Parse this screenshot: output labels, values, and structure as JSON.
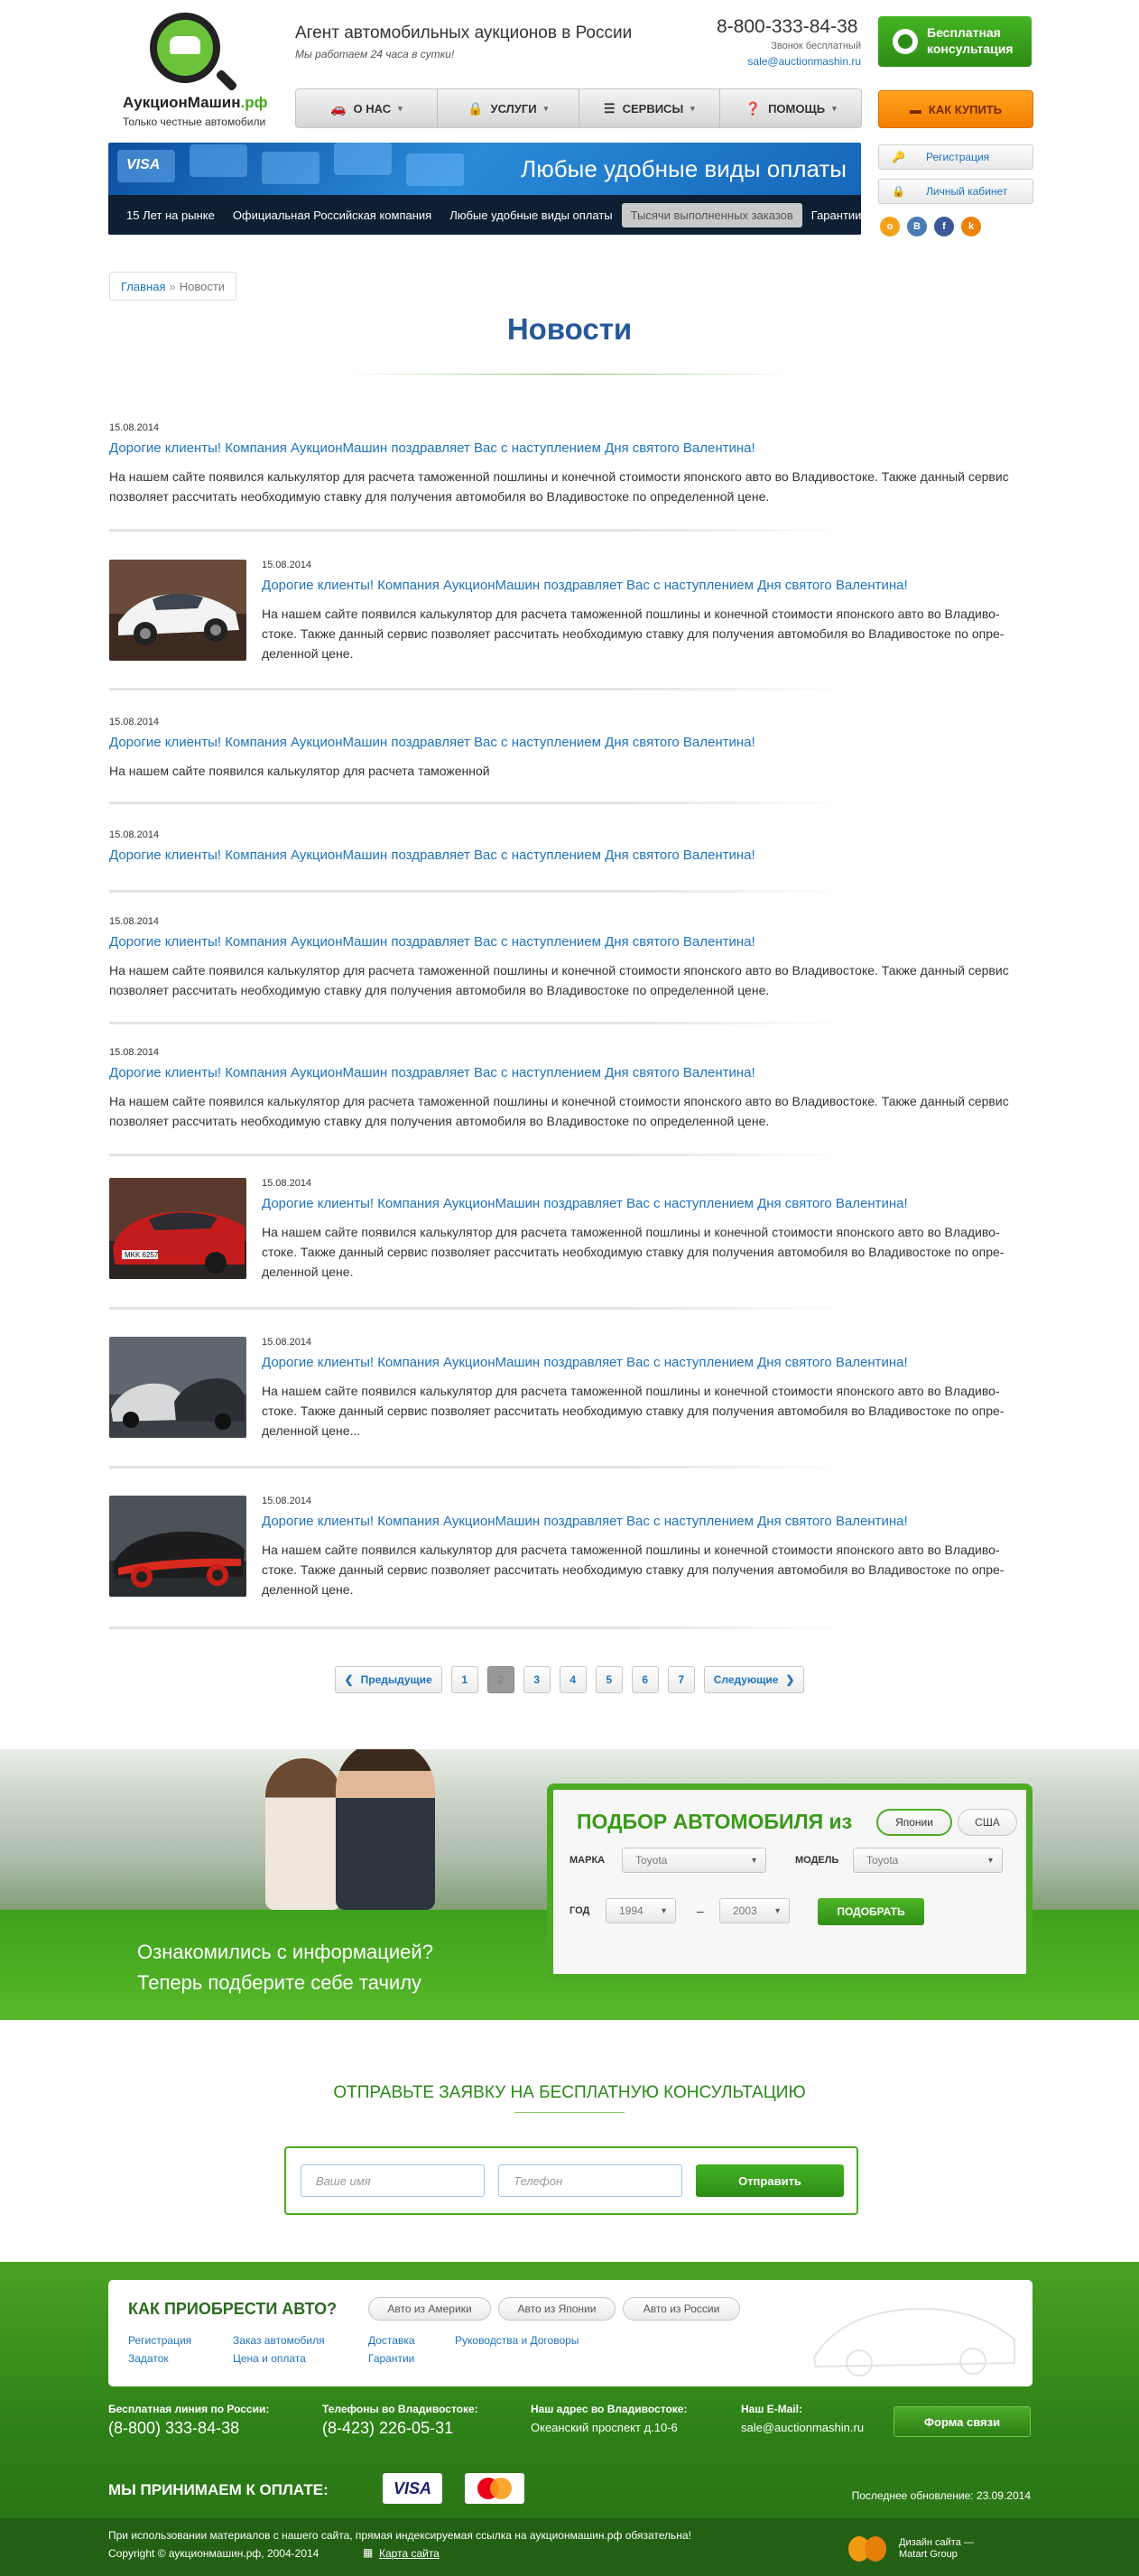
{
  "header": {
    "logo_name_main": "АукционМашин",
    "logo_name_tld": ".рф",
    "logo_tagline": "Только честные автомобили",
    "title": "Агент автомобильных аукционов в России",
    "subtitle": "Мы работаем 24 часа в сутки!",
    "phone": "8-800-333-84-38",
    "phone_note": "Звонок бесплатный",
    "email": "sale@auctionmashin.ru",
    "consult_button": "Бесплатная консультация",
    "buy_button": "КАК КУПИТЬ",
    "nav": [
      {
        "label": "О НАС",
        "icon": "car-icon"
      },
      {
        "label": "УСЛУГИ",
        "icon": "bag-icon"
      },
      {
        "label": "СЕРВИСЫ",
        "icon": "list-icon"
      },
      {
        "label": "ПОМОЩЬ",
        "icon": "help-icon"
      }
    ],
    "register": "Регистрация",
    "cabinet": "Личный кабинет",
    "socials": [
      "odnoklassniki",
      "vkontakte",
      "facebook",
      "ok"
    ]
  },
  "banner": {
    "headline": "Любые удобные виды оплаты",
    "card_text": "VISA",
    "items": [
      "15 Лет на рынке",
      "Официальная Российская компания",
      "Любые удобные виды оплаты",
      "Тысячи выполненных заказов",
      "Гарантии"
    ],
    "active_index": 3
  },
  "breadcrumb": {
    "home": "Главная",
    "sep": "»",
    "current": "Новости"
  },
  "page_title": "Новости",
  "news": [
    {
      "date": "15.08.2014",
      "title": "Дорогие клиенты! Компания АукционМашин поздравляет Вас с наступлением Дня святого Валентина!",
      "text": "На нашем сайте появился калькулятор для расчета таможенной пошлины и конечной стоимости японского авто во Владивостоке. Также данный сервис позволяет рассчитать необходимую ставку для получения автомобиля во Владивостоке по определенной цене."
    },
    {
      "date": "15.08.2014",
      "title": "Дорогие клиенты! Компания АукционМашин поздравляет Вас с наступлением Дня святого Валентина!",
      "text": "На нашем сайте появился калькулятор для расчета таможенной пошлины и конечной стоимости японского авто во Владиво-стоке. Также данный сервис позволяет рассчитать необходимую ставку для получения автомобиля во Владивостоке по опре-деленной цене.",
      "image": "white-sports-car"
    },
    {
      "date": "15.08.2014",
      "title": "Дорогие клиенты! Компания АукционМашин поздравляет Вас с наступлением Дня святого Валентина!",
      "text": "На нашем сайте появился калькулятор для расчета таможенной"
    },
    {
      "date": "15.08.2014",
      "title": "Дорогие клиенты! Компания АукционМашин поздравляет Вас с наступлением Дня святого Валентина!",
      "text": ""
    },
    {
      "date": "15.08.2014",
      "title": "Дорогие клиенты! Компания АукционМашин поздравляет Вас с наступлением Дня святого Валентина!",
      "text": "На нашем сайте появился калькулятор для расчета таможенной пошлины и конечной стоимости японского авто во Владивостоке. Также данный сервис позволяет рассчитать необходимую ставку для получения автомобиля во Владивостоке по определенной цене."
    },
    {
      "date": "15.08.2014",
      "title": "Дорогие клиенты! Компания АукционМашин поздравляет Вас с наступлением Дня святого Валентина!",
      "text": "На нашем сайте появился калькулятор для расчета таможенной пошлины и конечной стоимости японского авто во Владивостоке. Также данный сервис позволяет рассчитать необходимую ставку для получения автомобиля во Владивостоке по определенной цене."
    },
    {
      "date": "15.08.2014",
      "title": "Дорогие клиенты! Компания АукционМашин поздравляет Вас с наступлением Дня святого Валентина!",
      "text": "На нашем сайте появился калькулятор для расчета таможенной пошлины и конечной стоимости японского авто во Владиво-стоке. Также данный сервис позволяет рассчитать необходимую ставку для получения автомобиля во Владивостоке по опре-деленной цене.",
      "image": "red-bmw",
      "plate": "MKK 6257"
    },
    {
      "date": "15.08.2014",
      "title": "Дорогие клиенты! Компания АукционМашин поздравляет Вас с наступлением Дня святого Валентина!",
      "text": "На нашем сайте появился калькулятор для расчета таможенной пошлины и конечной стоимости японского авто во Владиво-стоке. Также данный сервис позволяет рассчитать необходимую ставку для получения автомобиля во Владивостоке по опре-деленной цене...",
      "image": "silver-porsche"
    },
    {
      "date": "15.08.2014",
      "title": "Дорогие клиенты! Компания АукционМашин поздравляет Вас с наступлением Дня святого Валентина!",
      "text": "На нашем сайте появился калькулятор для расчета таможенной пошлины и конечной стоимости японского авто во Владиво-стоке. Также данный сервис позволяет рассчитать необходимую ставку для получения автомобиля во Владивостоке по опре-деленной цене.",
      "image": "black-red-supercar"
    }
  ],
  "pager": {
    "prev": "Предыдущие",
    "next": "Следующие",
    "pages": [
      "1",
      "2",
      "3",
      "4",
      "5",
      "6",
      "7"
    ],
    "current": "2"
  },
  "selection": {
    "promo": [
      "Ознакомились с информацией?",
      "Теперь подберите себе тачилу"
    ],
    "title": "ПОДБОР АВТОМОБИЛЯ из",
    "countries": [
      "Японии",
      "США"
    ],
    "make_label": "МАРКА",
    "make_value": "Toyota",
    "model_label": "МОДЕЛЬ",
    "model_value": "Toyota",
    "year_label": "ГОД",
    "year_from": "1994",
    "year_sep": "–",
    "year_to": "2003",
    "submit": "ПОДОБРАТЬ"
  },
  "consult": {
    "title": "ОТПРАВЬТЕ ЗАЯВКУ НА БЕСПЛАТНУЮ КОНСУЛЬТАЦИЮ",
    "name_placeholder": "Ваше имя",
    "phone_placeholder": "Телефон",
    "submit": "Отправить"
  },
  "footer": {
    "buy_title": "КАК ПРИОБРЕСТИ АВТО?",
    "buy_tabs": [
      "Авто из Америки",
      "Авто из Японии",
      "Авто из России"
    ],
    "links": [
      "Регистрация",
      "Заказ автомобиля",
      "Доставка",
      "Руководства и Договоры",
      "Задаток",
      "Цена и оплата",
      "Гарантии"
    ],
    "hotline_label": "Бесплатная линия по России:",
    "hotline": "(8-800) 333-84-38",
    "vlad_label": "Телефоны во Владивостоке:",
    "vlad": "(8-423) 226-05-31",
    "addr_label": "Наш адрес во Владивостоке:",
    "addr": "Океанский проспект д.10-6",
    "email_label": "Наш E-Mail:",
    "email": "sale@auctionmashin.ru",
    "contact_button": "Форма связи",
    "pay_title": "МЫ ПРИНИМАЕМ К ОПЛАТЕ:",
    "visa": "VISA",
    "updated": "Последнее обновление: 23.09.2014",
    "notice": "При использовании материалов с нашего сайта, прямая индексируемая ссылка на аукционмашин.рф обязательна!",
    "copyright": "Copyright © аукционмашин.рф, 2004-2014",
    "sitemap": "Карта сайта",
    "design_line1": "Дизайн сайта —",
    "design_line2": "Matart Group"
  },
  "colors": {
    "brand_green": "#4cab22",
    "link_blue": "#1e73be",
    "title_blue": "#275999",
    "orange": "#f47d00"
  }
}
